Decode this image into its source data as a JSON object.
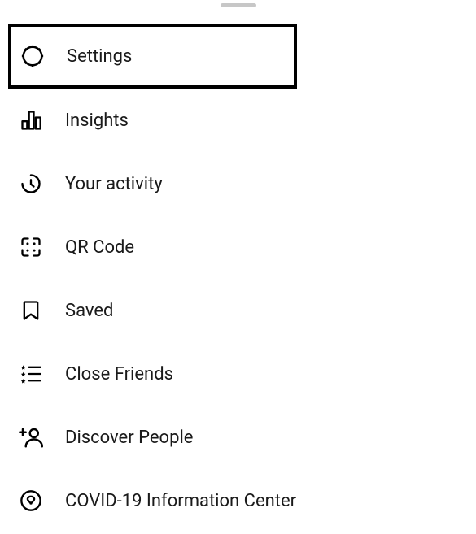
{
  "menu": {
    "items": [
      {
        "label": "Settings"
      },
      {
        "label": "Insights"
      },
      {
        "label": "Your activity"
      },
      {
        "label": "QR Code"
      },
      {
        "label": "Saved"
      },
      {
        "label": "Close Friends"
      },
      {
        "label": "Discover People"
      },
      {
        "label": "COVID-19 Information Center"
      }
    ]
  }
}
